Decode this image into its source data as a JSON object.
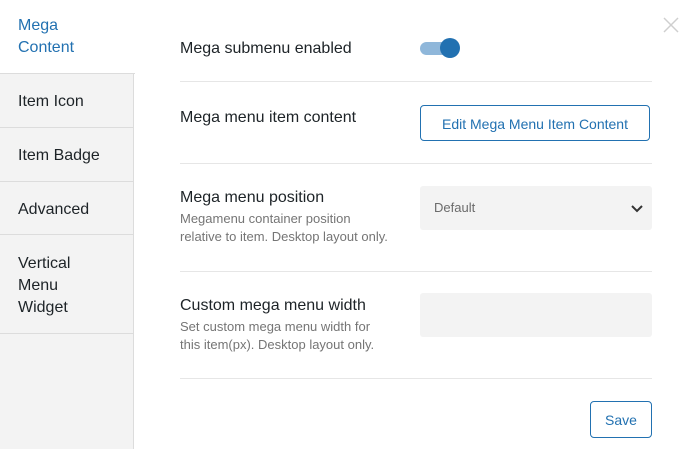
{
  "sidebar": {
    "tabs": [
      {
        "label": "Mega\nContent",
        "active": true
      },
      {
        "label": "Item Icon",
        "active": false
      },
      {
        "label": "Item Badge",
        "active": false
      },
      {
        "label": "Advanced",
        "active": false
      },
      {
        "label": "Vertical\nMenu\nWidget",
        "active": false
      }
    ]
  },
  "close": {
    "icon": "close-icon"
  },
  "settings": {
    "submenu_enabled": {
      "label": "Mega submenu enabled",
      "value": true
    },
    "item_content": {
      "label": "Mega menu item content",
      "button_label": "Edit Mega Menu Item Content"
    },
    "position": {
      "label": "Mega menu position",
      "description": "Megamenu container position\nrelative to item. Desktop layout only.",
      "selected": "Default"
    },
    "width": {
      "label": "Custom mega menu width",
      "description": "Set custom mega menu width for\nthis item(px). Desktop layout only.",
      "value": ""
    }
  },
  "footer": {
    "save_label": "Save"
  },
  "colors": {
    "accent": "#2271b1",
    "toggle_track": "#8fb7da",
    "sidebar_bg": "#f3f3f3",
    "field_bg": "#f3f3f3"
  }
}
